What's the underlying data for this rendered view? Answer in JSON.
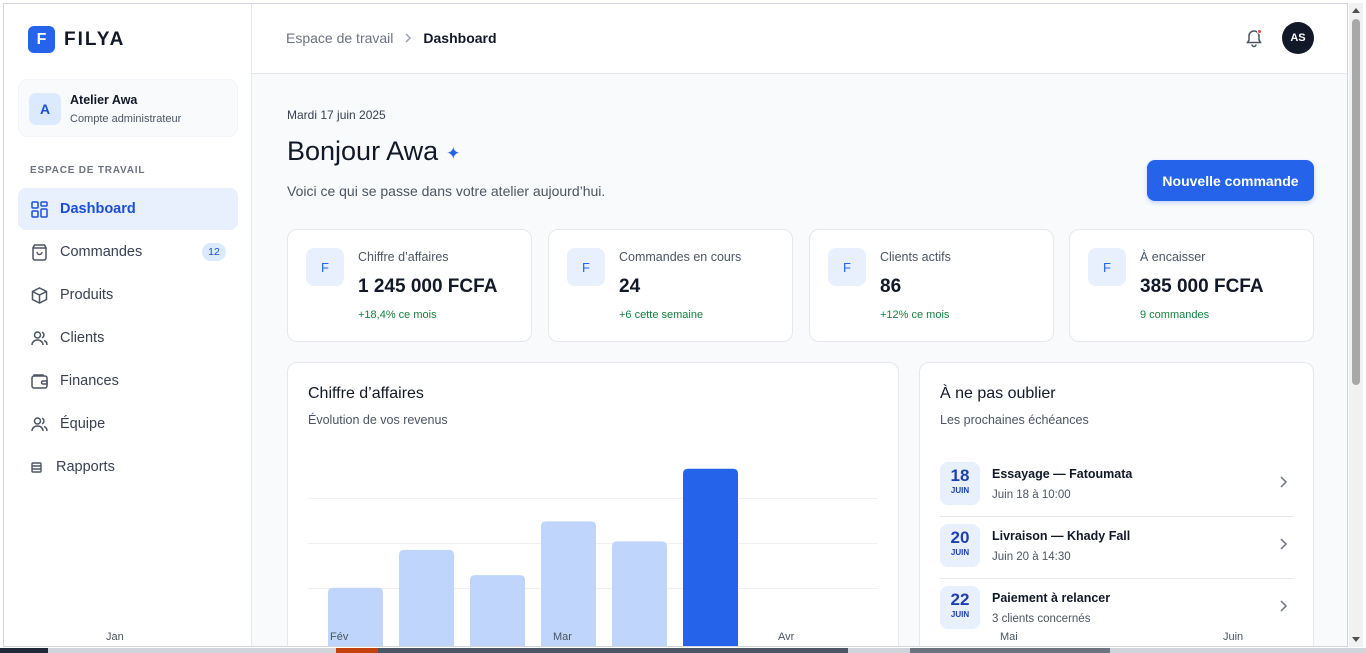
{
  "brand": {
    "mark": "F",
    "name": "FILYA"
  },
  "account": {
    "avatar": "A",
    "name": "Atelier Awa",
    "role": "Compte administrateur"
  },
  "sidebar": {
    "section_title": "ESPACE DE TRAVAIL",
    "items": [
      {
        "label": "Dashboard",
        "icon": "dashboard-grid-icon",
        "active": true
      },
      {
        "label": "Commandes",
        "icon": "shopping-bag-icon",
        "badge": "12"
      },
      {
        "label": "Produits",
        "icon": "box-icon"
      },
      {
        "label": "Clients",
        "icon": "users-icon"
      },
      {
        "label": "Finances",
        "icon": "wallet-icon"
      },
      {
        "label": "Équipe",
        "icon": "team-icon"
      },
      {
        "label": "Rapports",
        "icon": "report-icon"
      }
    ]
  },
  "topbar": {
    "breadcrumb": [
      "Espace de travail",
      "Dashboard"
    ],
    "user_initials": "AS"
  },
  "header": {
    "date": "Mardi 17 juin 2025",
    "greeting": "Bonjour Awa",
    "spark": "✦",
    "subtitle": "Voici ce qui se passe dans votre atelier aujourd’hui.",
    "new_order_label": "Nouvelle commande"
  },
  "kpis": [
    {
      "icon": "F",
      "label": "Chiffre d’affaires",
      "value": "1 245 000 FCFA",
      "delta": "+18,4% ce mois"
    },
    {
      "icon": "F",
      "label": "Commandes en cours",
      "value": "24",
      "delta": "+6 cette semaine"
    },
    {
      "icon": "F",
      "label": "Clients actifs",
      "value": "86",
      "delta": "+12% ce mois"
    },
    {
      "icon": "F",
      "label": "À encaisser",
      "value": "385 000 FCFA",
      "delta": "9 commandes"
    }
  ],
  "revenue_card": {
    "title": "Chiffre d’affaires",
    "subtitle": "Évolution de vos revenus"
  },
  "chart_data": {
    "type": "bar",
    "categories": [
      "Jan",
      "Fév",
      "Mar",
      "Avr",
      "Mai",
      "Juin"
    ],
    "visible_axis_labels": [
      "Jan",
      "Fév",
      "Mar",
      "Avr",
      "Mai",
      "Juin"
    ],
    "values": [
      62,
      98,
      74,
      125,
      106,
      175
    ],
    "highlight_index": 5,
    "colors": {
      "bar": "#bfd5fb",
      "highlight": "#2563eb",
      "grid": "#eef0f3"
    },
    "grid": true
  },
  "reminders": {
    "title": "À ne pas oublier",
    "subtitle": "Les prochaines échéances",
    "items": [
      {
        "day": "18",
        "month": "JUIN",
        "title": "Essayage — Fatoumata",
        "detail": "Juin 18 à 10:00"
      },
      {
        "day": "20",
        "month": "JUIN",
        "title": "Livraison — Khady Fall",
        "detail": "Juin 20 à 14:30"
      },
      {
        "day": "22",
        "month": "JUIN",
        "title": "Paiement à relancer",
        "detail": "3 clients concernés"
      }
    ]
  },
  "colors": {
    "accent": "#2563eb",
    "positive": "#15803d"
  }
}
